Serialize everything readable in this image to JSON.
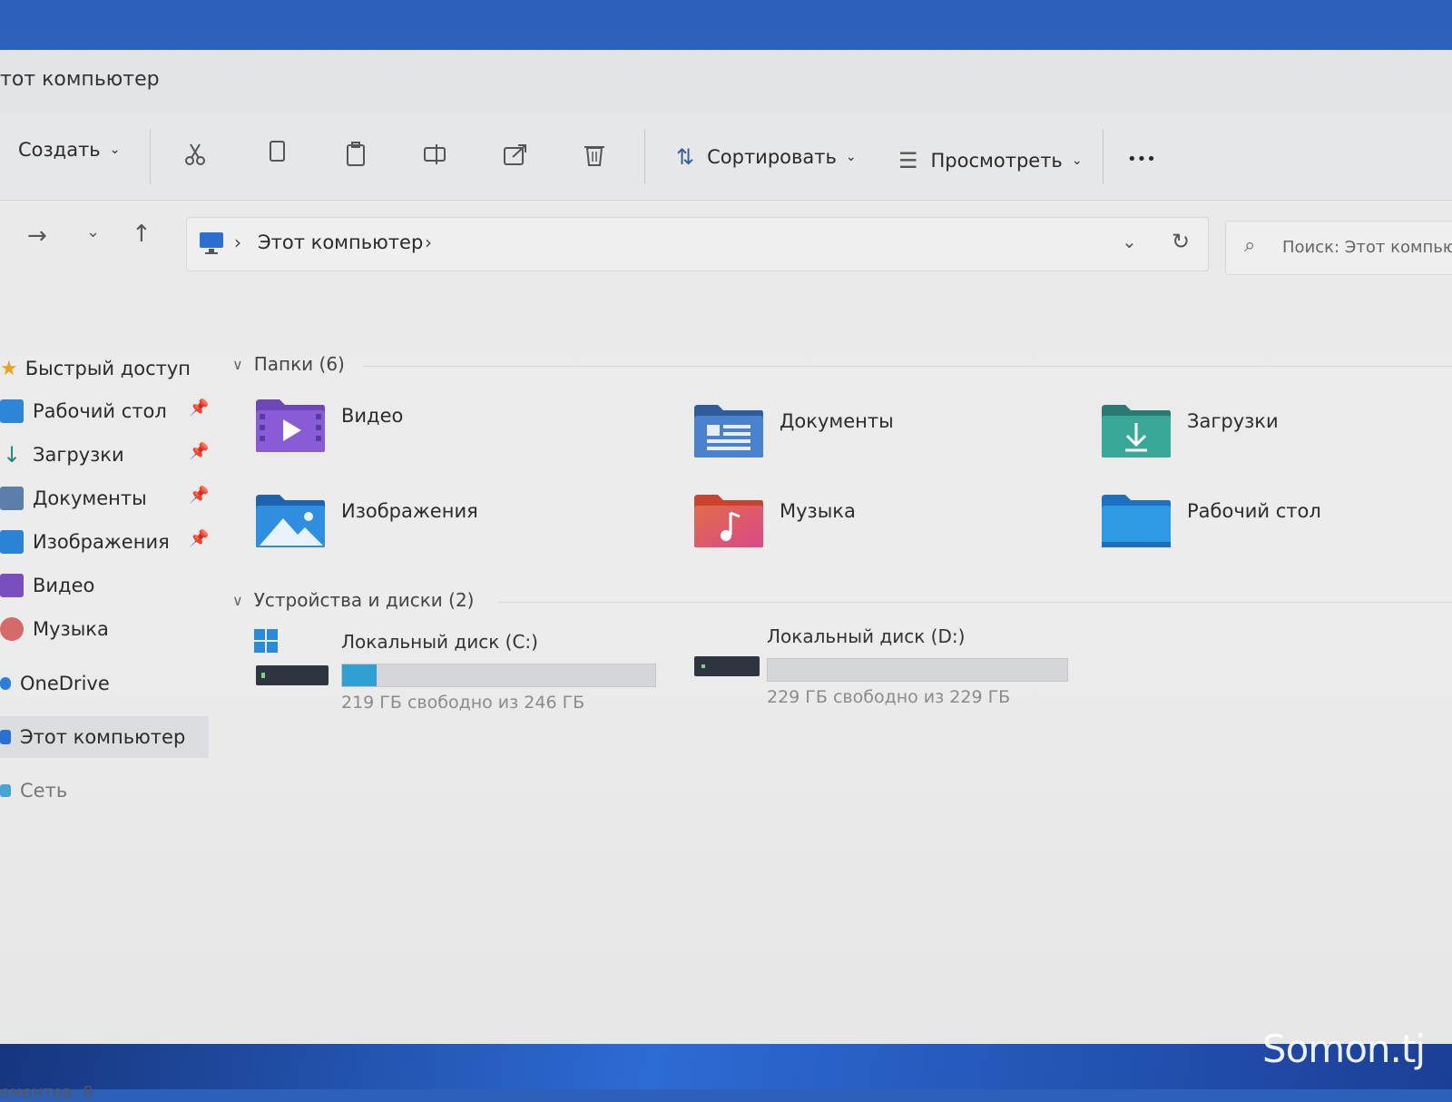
{
  "window": {
    "title": "тот компьютер"
  },
  "toolbar": {
    "create_label": "Создать",
    "sort_label": "Сортировать",
    "view_label": "Просмотреть",
    "more_label": "•••"
  },
  "address": {
    "crumb": "Этот компьютер",
    "separator": "›",
    "search_placeholder": "Поиск: Этот компьютер"
  },
  "sidebar": {
    "quick_access": "Быстрый доступ",
    "items": [
      {
        "label": "Рабочий стол",
        "pinned": true
      },
      {
        "label": "Загрузки",
        "pinned": true
      },
      {
        "label": "Документы",
        "pinned": true
      },
      {
        "label": "Изображения",
        "pinned": true
      },
      {
        "label": "Видео",
        "pinned": false
      },
      {
        "label": "Музыка",
        "pinned": false
      }
    ],
    "onedrive": "OneDrive",
    "this_pc": "Этот компьютер",
    "network": "Сеть"
  },
  "folders": {
    "header": "Папки (6)",
    "items": [
      {
        "label": "Видео",
        "icon": "video-folder-icon"
      },
      {
        "label": "Документы",
        "icon": "documents-folder-icon"
      },
      {
        "label": "Загрузки",
        "icon": "downloads-folder-icon"
      },
      {
        "label": "Изображения",
        "icon": "pictures-folder-icon"
      },
      {
        "label": "Музыка",
        "icon": "music-folder-icon"
      },
      {
        "label": "Рабочий стол",
        "icon": "desktop-folder-icon"
      }
    ]
  },
  "devices": {
    "header": "Устройства и диски (2)",
    "items": [
      {
        "label": "Локальный диск (C:)",
        "free": "219 ГБ свободно из 246 ГБ",
        "used_fraction": 0.11
      },
      {
        "label": "Локальный диск (D:)",
        "free": "229 ГБ свободно из 229 ГБ",
        "used_fraction": 0.0
      }
    ]
  },
  "status": {
    "items_count": "ементов: 8"
  },
  "brand": "Somon.tj",
  "colors": {
    "accent": "#2f9fd4",
    "wallpaper": "#2c5fb8"
  }
}
